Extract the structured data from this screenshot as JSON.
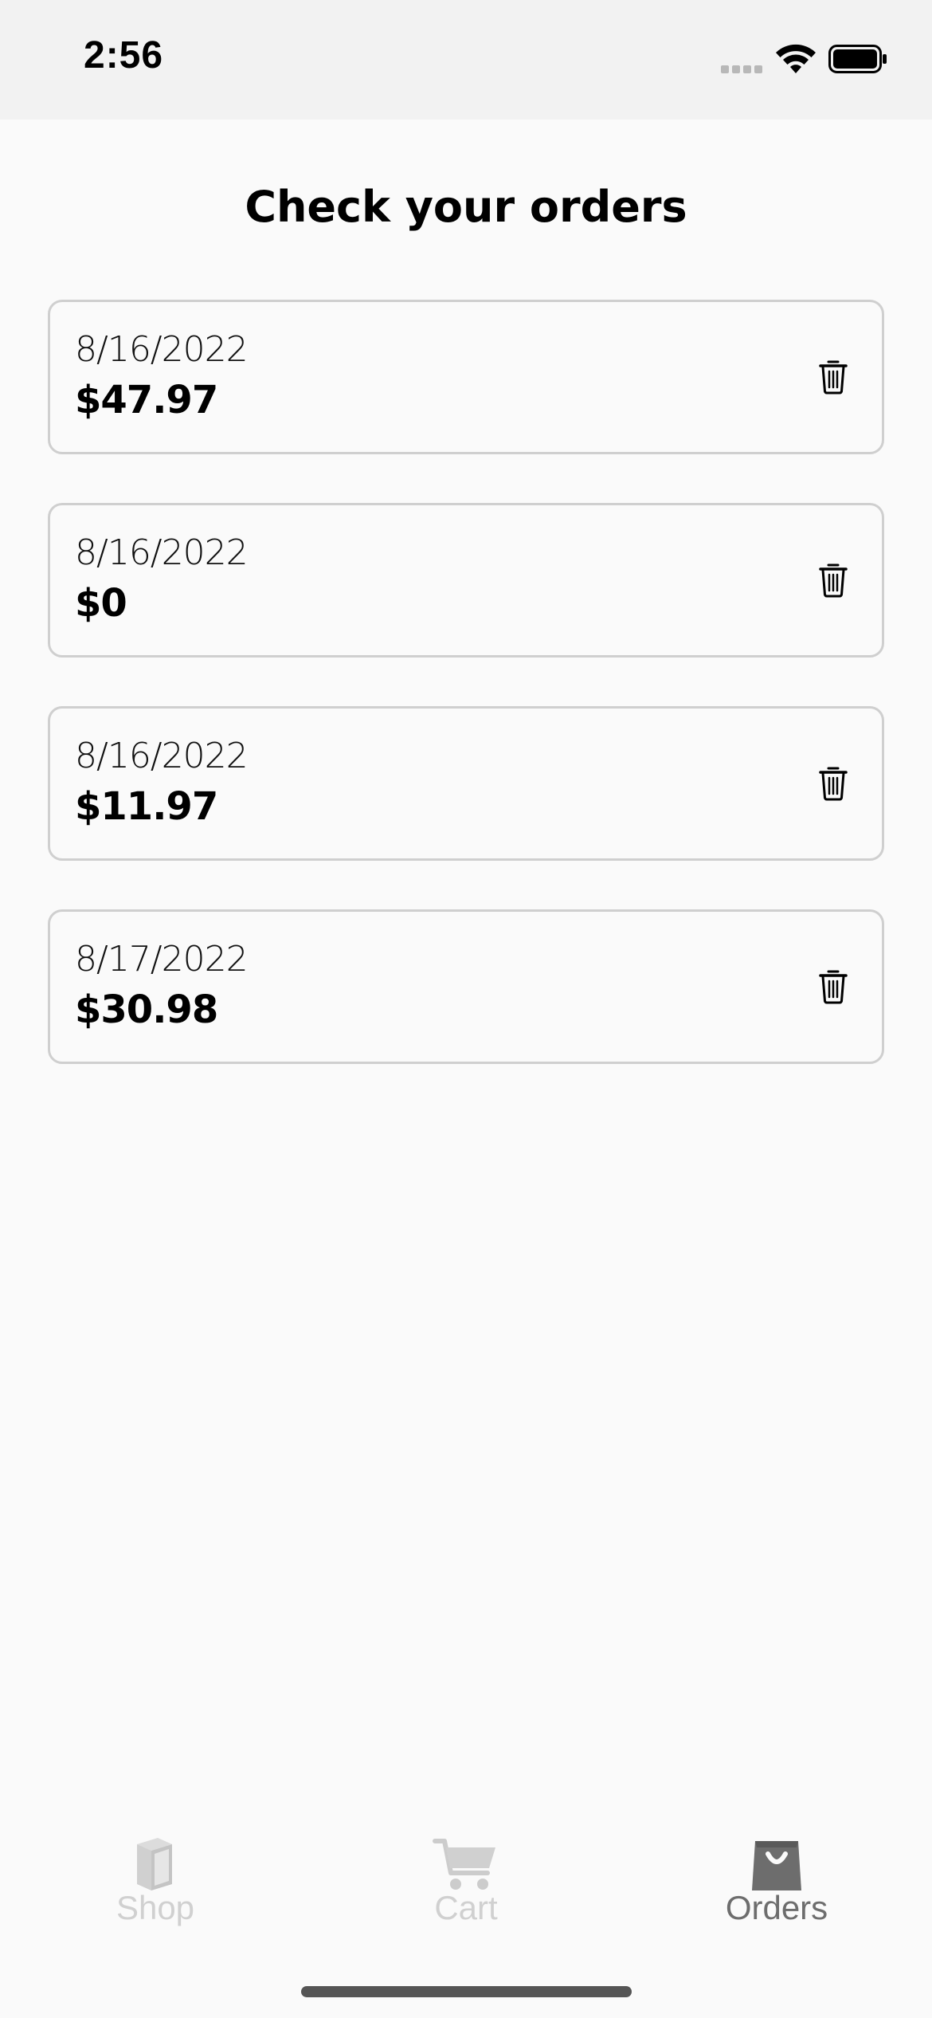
{
  "status_bar": {
    "time": "2:56"
  },
  "page": {
    "title": "Check your orders"
  },
  "orders": [
    {
      "date": "8/16/2022",
      "total": "$47.97"
    },
    {
      "date": "8/16/2022",
      "total": "$0"
    },
    {
      "date": "8/16/2022",
      "total": "$11.97"
    },
    {
      "date": "8/17/2022",
      "total": "$30.98"
    }
  ],
  "order_actions": {
    "delete_icon": "trash-icon"
  },
  "tab_bar": {
    "tabs": [
      {
        "label": "Shop",
        "icon": "book-icon",
        "active": false
      },
      {
        "label": "Cart",
        "icon": "cart-icon",
        "active": false
      },
      {
        "label": "Orders",
        "icon": "shopping-bag-icon",
        "active": true
      }
    ],
    "active_color": "#6d6d6d",
    "inactive_color": "#d0d0d0"
  }
}
